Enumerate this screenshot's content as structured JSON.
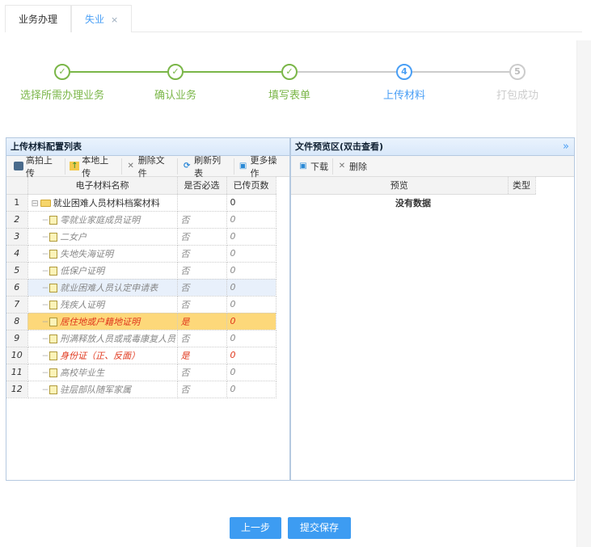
{
  "tabs": [
    {
      "label": "业务办理"
    },
    {
      "label": "失业",
      "close": "×"
    }
  ],
  "steps": [
    {
      "label": "选择所需办理业务",
      "mark": "✓"
    },
    {
      "label": "确认业务",
      "mark": "✓"
    },
    {
      "label": "填写表单",
      "mark": "✓"
    },
    {
      "label": "上传材料",
      "mark": "4"
    },
    {
      "label": "打包成功",
      "mark": "5"
    }
  ],
  "left": {
    "title": "上传材料配置列表",
    "toolbar": [
      "高拍上传",
      "本地上传",
      "删除文件",
      "刷新列表",
      "更多操作"
    ],
    "columns": [
      "电子材料名称",
      "是否必选",
      "已传页数"
    ],
    "rows": [
      {
        "n": "1",
        "name": "就业困难人员材料档案材料",
        "req": "",
        "pages": "0"
      },
      {
        "n": "2",
        "name": "零就业家庭成员证明",
        "req": "否",
        "pages": "0"
      },
      {
        "n": "3",
        "name": "二女户",
        "req": "否",
        "pages": "0"
      },
      {
        "n": "4",
        "name": "失地失海证明",
        "req": "否",
        "pages": "0"
      },
      {
        "n": "5",
        "name": "低保户证明",
        "req": "否",
        "pages": "0"
      },
      {
        "n": "6",
        "name": "就业困难人员认定申请表",
        "req": "否",
        "pages": "0"
      },
      {
        "n": "7",
        "name": "残疾人证明",
        "req": "否",
        "pages": "0"
      },
      {
        "n": "8",
        "name": "居住地或户籍地证明",
        "req": "是",
        "pages": "0"
      },
      {
        "n": "9",
        "name": "刑满释放人员或戒毒康复人员",
        "req": "否",
        "pages": "0"
      },
      {
        "n": "10",
        "name": "身份证（正、反面）",
        "req": "是",
        "pages": "0"
      },
      {
        "n": "11",
        "name": "高校毕业生",
        "req": "否",
        "pages": "0"
      },
      {
        "n": "12",
        "name": "驻层部队随军家属",
        "req": "否",
        "pages": "0"
      }
    ]
  },
  "right": {
    "title": "文件预览区(双击查看)",
    "collapse": "»",
    "toolbar": [
      "下载",
      "删除"
    ],
    "columns": [
      "预览",
      "类型"
    ],
    "empty": "没有数据"
  },
  "buttons": {
    "prev": "上一步",
    "submit": "提交保存"
  }
}
